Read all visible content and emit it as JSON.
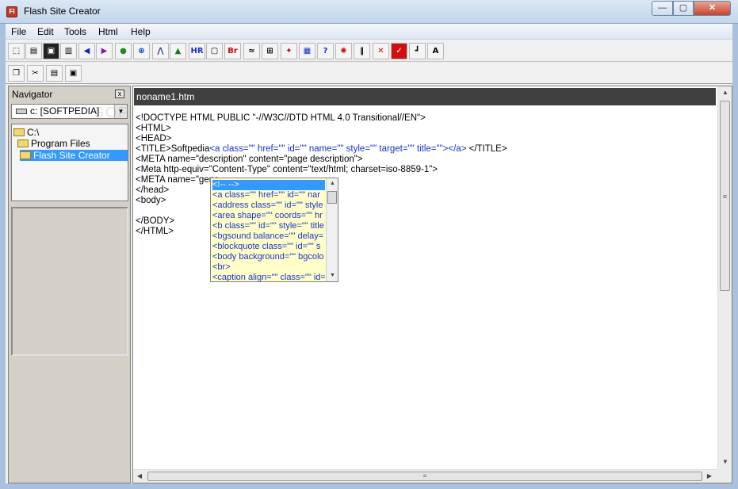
{
  "window": {
    "title": "Flash Site Creator",
    "app_icon_label": "FI",
    "minimize": "—",
    "maximize": "▢",
    "close": "✕"
  },
  "menu": [
    "File",
    "Edit",
    "Tools",
    "Html",
    "Help"
  ],
  "toolbar_icons": [
    "new-page-icon",
    "open-icon",
    "save-icon",
    "save-as-icon",
    "back-icon",
    "forward-icon",
    "globe-icon",
    "add-icon",
    "tree-icon",
    "image-icon",
    "hr-icon",
    "frame-icon",
    "br-icon",
    "form-icon",
    "table-icon",
    "flash-icon",
    "grid-icon",
    "help-icon",
    "record-icon",
    "columns-icon",
    "delete-icon",
    "check-icon",
    "align-icon",
    "font-icon"
  ],
  "toolbar_labels": {
    "hr": "HR",
    "br": "Br",
    "font": "A"
  },
  "edit_toolbar_icons": [
    "copy-icon",
    "cut-icon",
    "paste-icon",
    "select-all-icon"
  ],
  "navigator": {
    "title": "Navigator",
    "close": "x",
    "drive": "c: [SOFTPEDIA]",
    "tree": [
      "C:\\",
      "Program Files",
      "Flash Site Creator"
    ]
  },
  "editor": {
    "tab_title": "noname1.htm",
    "lines": [
      {
        "text": "<!DOCTYPE HTML PUBLIC \"-//W3C//DTD HTML 4.0 Transitional//EN\">"
      },
      {
        "text": "<HTML>"
      },
      {
        "text": "<HEAD>"
      },
      {
        "pre": "<TITLE>Softpedia",
        "blue": "<a class=\"\" href=\"\" id=\"\" name=\"\" style=\"\" target=\"\" title=\"\"></a>",
        "post": " </TITLE>"
      },
      {
        "text": "<META name=\"description\" content=\"page description\">"
      },
      {
        "text": "<Meta http-equiv=\"Content-Type\" content=\"text/html; charset=iso-8859-1\">"
      },
      {
        "text": "<META name=\"gene"
      },
      {
        "text": "</head>"
      },
      {
        "text": "<body>"
      },
      {
        "text": ""
      },
      {
        "text": "</BODY>"
      },
      {
        "text": "</HTML>"
      }
    ]
  },
  "autocomplete": {
    "items": [
      "<!-- -->",
      "<a class=\"\" href=\"\" id=\"\" nar",
      "<address class=\"\" id=\"\" style",
      "<area shape=\"\" coords=\"\" hr",
      "<b class=\"\" id=\"\" style=\"\" title",
      "<bgsound balance=\"\" delay=",
      "<blockquote class=\"\" id=\"\" s",
      "<body background=\"\" bgcolo",
      "<br>",
      "<caption align=\"\" class=\"\" id="
    ],
    "selected_index": 0
  },
  "watermark": "SOFTPEDIA",
  "scrollbars": {
    "v_grip": "≡",
    "h_grip": "≡"
  }
}
